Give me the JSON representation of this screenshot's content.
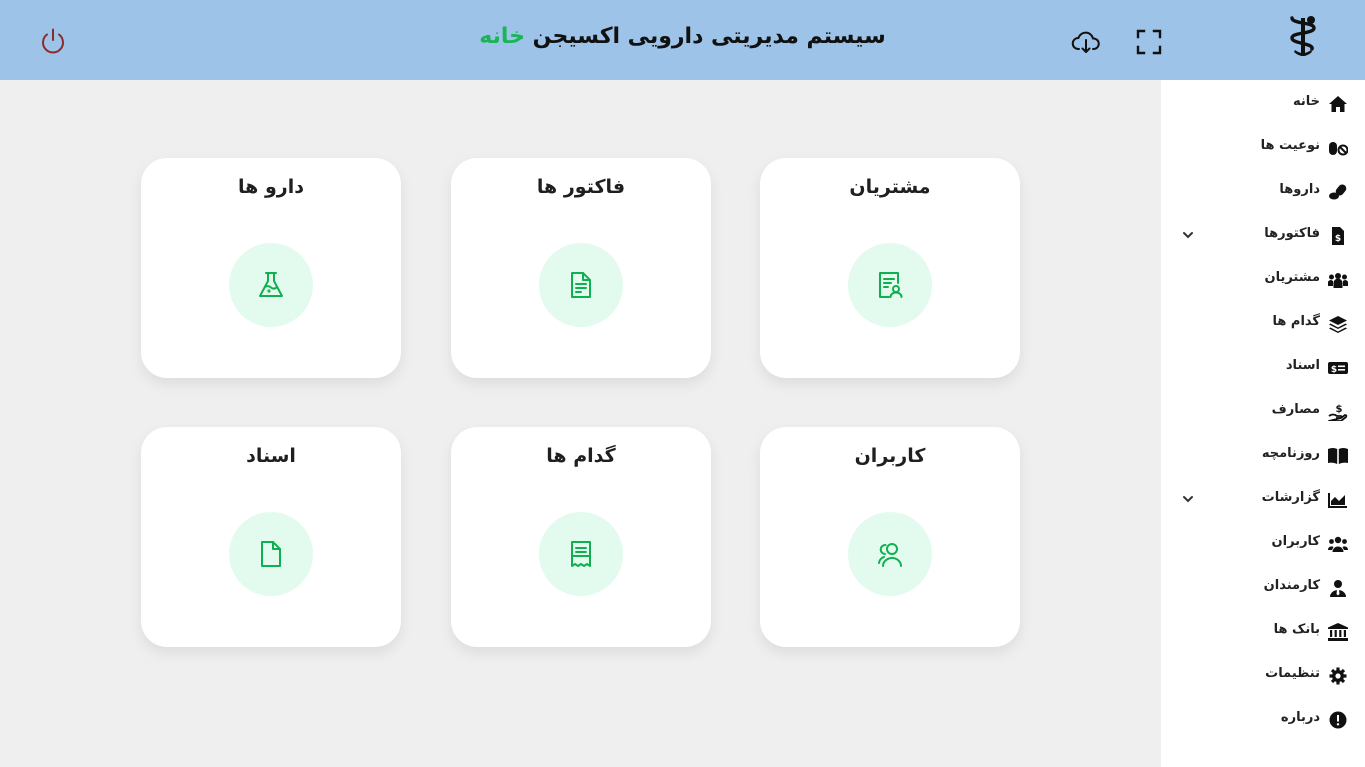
{
  "header": {
    "title_main": "سیستم مدیریتی دارویی اکسیجن",
    "title_accent": "خانه",
    "accent_color": "#1ab556",
    "background_color": "#9dc3e8",
    "icons": [
      "power-icon",
      "cloud-download-icon",
      "fullscreen-icon",
      "pharmacy-logo-icon"
    ]
  },
  "sidebar": {
    "items": [
      {
        "label": "خانه",
        "icon": "home-icon"
      },
      {
        "label": "نوعیت ها",
        "icon": "pills-icon"
      },
      {
        "label": "داروها",
        "icon": "capsules-icon"
      },
      {
        "label": "فاکتورها",
        "icon": "invoice-dollar-icon",
        "has_submenu": true
      },
      {
        "label": "مشتریان",
        "icon": "people-group-icon"
      },
      {
        "label": "گدام ها",
        "icon": "layers-icon"
      },
      {
        "label": "اسناد",
        "icon": "money-bill-icon"
      },
      {
        "label": "مصارف",
        "icon": "hand-holding-dollar-icon"
      },
      {
        "label": "روزنامچه",
        "icon": "book-open-icon"
      },
      {
        "label": "گزارشات",
        "icon": "area-chart-icon",
        "has_submenu": true
      },
      {
        "label": "کاربران",
        "icon": "users-icon"
      },
      {
        "label": "کارمندان",
        "icon": "user-tie-icon"
      },
      {
        "label": "بانک ها",
        "icon": "bank-icon"
      },
      {
        "label": "تنظیمات",
        "icon": "gear-icon"
      },
      {
        "label": "درباره",
        "icon": "info-circle-icon"
      }
    ]
  },
  "cards": [
    {
      "title": "مشتریان",
      "icon": "customer-certificate-icon"
    },
    {
      "title": "فاکتور ها",
      "icon": "document-lines-icon"
    },
    {
      "title": "دارو ها",
      "icon": "flask-icon"
    },
    {
      "title": "کاربران",
      "icon": "users-outline-icon"
    },
    {
      "title": "گدام ها",
      "icon": "receipt-icon"
    },
    {
      "title": "اسناد",
      "icon": "file-icon"
    }
  ],
  "card_icon_color": "#10b050",
  "card_circle_color": "#e3fbee"
}
